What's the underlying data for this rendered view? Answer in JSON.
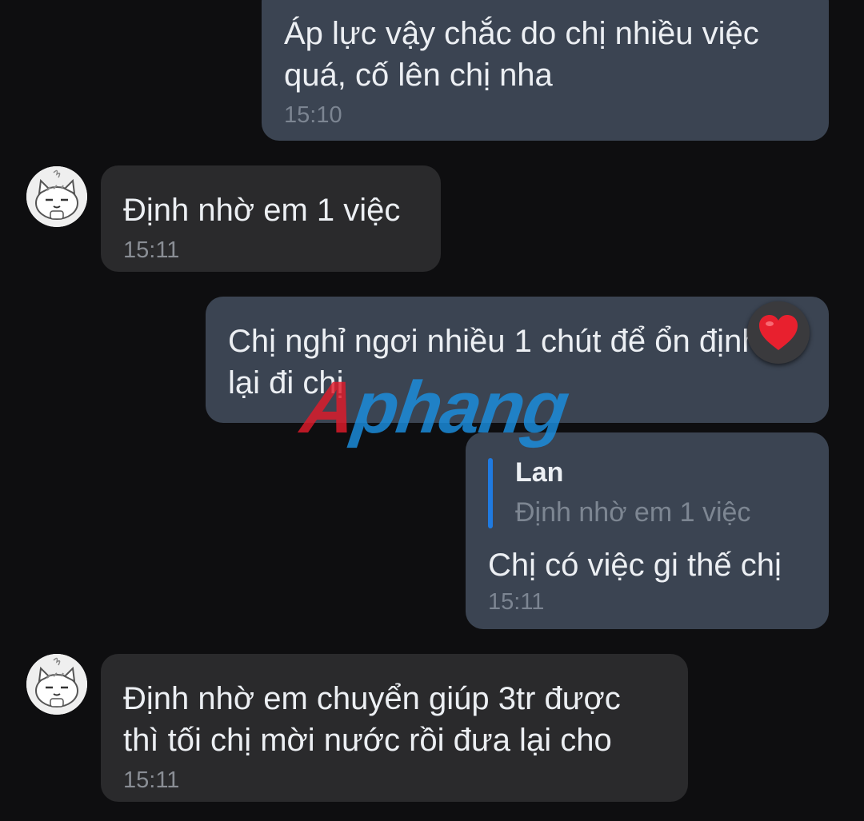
{
  "colors": {
    "background": "#0e0e10",
    "outgoing_bubble": "#3b4452",
    "incoming_bubble": "#2a2a2c",
    "reply_bar": "#1f7ae0",
    "reaction_heart": "#e8202e",
    "watermark_red": "#e01b2a",
    "watermark_blue": "#1b8fe0"
  },
  "messages": [
    {
      "direction": "outgoing",
      "text": "Áp lực vậy chắc do chị nhiều việc\nquá, cố lên chị nha",
      "time": "15:10"
    },
    {
      "direction": "incoming",
      "avatar": "cat-sticker-avatar",
      "text": "Định nhờ em 1 việc",
      "time": "15:11"
    },
    {
      "direction": "outgoing",
      "text": "Chị nghỉ ngơi nhiều 1 chút để ổn định\nlại đi chị",
      "reaction": "heart-icon"
    },
    {
      "direction": "outgoing",
      "reply_to": {
        "name": "Lan",
        "text": "Định nhờ em 1 việc"
      },
      "text": "Chị có việc gi thế chị",
      "time": "15:11"
    },
    {
      "direction": "incoming",
      "avatar": "cat-sticker-avatar",
      "text": "Định nhờ em chuyển giúp 3tr được\nthì tối chị mời nước rồi đưa lại cho",
      "time": "15:11"
    }
  ],
  "watermark": {
    "first": "A",
    "rest": "phang"
  }
}
